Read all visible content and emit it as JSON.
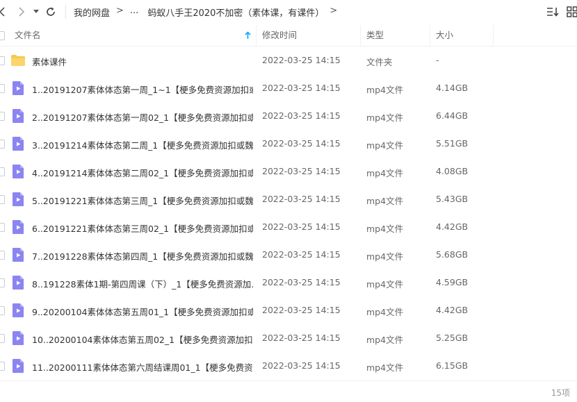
{
  "breadcrumb": {
    "root": "我的网盘",
    "sep": ">",
    "ellipsis": "...",
    "current": "蚂蚁八手王2020不加密（素体课，有课件）"
  },
  "header": {
    "name": "文件名",
    "modified": "修改时间",
    "type": "类型",
    "size": "大小"
  },
  "rows": [
    {
      "name": "素体课件",
      "date": "2022-03-25 14:15",
      "type": "文件夹",
      "size": "-",
      "icon": "folder-icon"
    },
    {
      "name": "1..20191207素体体态第一周_1~1【梗多免费资源加扣或...",
      "date": "2022-03-25 14:15",
      "type": "mp4文件",
      "size": "4.14GB",
      "icon": "video-file-icon"
    },
    {
      "name": "2..20191207素体体态第一周02_1【梗多免费资源加扣或...",
      "date": "2022-03-25 14:15",
      "type": "mp4文件",
      "size": "6.44GB",
      "icon": "video-file-icon"
    },
    {
      "name": "3..20191214素体体态第二周_1【梗多免费资源加扣或魏...",
      "date": "2022-03-25 14:15",
      "type": "mp4文件",
      "size": "5.51GB",
      "icon": "video-file-icon"
    },
    {
      "name": "4..20191214素体体态第二周02_1【梗多免费资源加扣或...",
      "date": "2022-03-25 14:15",
      "type": "mp4文件",
      "size": "4.08GB",
      "icon": "video-file-icon"
    },
    {
      "name": "5..20191221素体体态第三周_1【梗多免费资源加扣或魏...",
      "date": "2022-03-25 14:15",
      "type": "mp4文件",
      "size": "5.43GB",
      "icon": "video-file-icon"
    },
    {
      "name": "6..20191221素体体态第三周02_1【梗多免费资源加扣或...",
      "date": "2022-03-25 14:15",
      "type": "mp4文件",
      "size": "4.42GB",
      "icon": "video-file-icon"
    },
    {
      "name": "7..20191228素体体态第四周_1【梗多免费资源加扣或魏...",
      "date": "2022-03-25 14:15",
      "type": "mp4文件",
      "size": "5.68GB",
      "icon": "video-file-icon"
    },
    {
      "name": "8..191228素体1期-第四周课（下）_1【梗多免费资源加...",
      "date": "2022-03-25 14:15",
      "type": "mp4文件",
      "size": "4.59GB",
      "icon": "video-file-icon"
    },
    {
      "name": "9..20200104素体体态第五周01_1【梗多免费资源加扣或...",
      "date": "2022-03-25 14:15",
      "type": "mp4文件",
      "size": "4.42GB",
      "icon": "video-file-icon"
    },
    {
      "name": "10..20200104素体体态第五周02_1【梗多免费资源加扣...",
      "date": "2022-03-25 14:15",
      "type": "mp4文件",
      "size": "5.25GB",
      "icon": "video-file-icon"
    },
    {
      "name": "11..20200111素体体态第六周结课周01_1【梗多免费资...",
      "date": "2022-03-25 14:15",
      "type": "mp4文件",
      "size": "6.15GB",
      "icon": "video-file-icon"
    }
  ],
  "footer": {
    "count": "15项"
  },
  "colors": {
    "folder": "#f9c74f",
    "video": "#8c84f0",
    "accent": "#06a7ff"
  }
}
